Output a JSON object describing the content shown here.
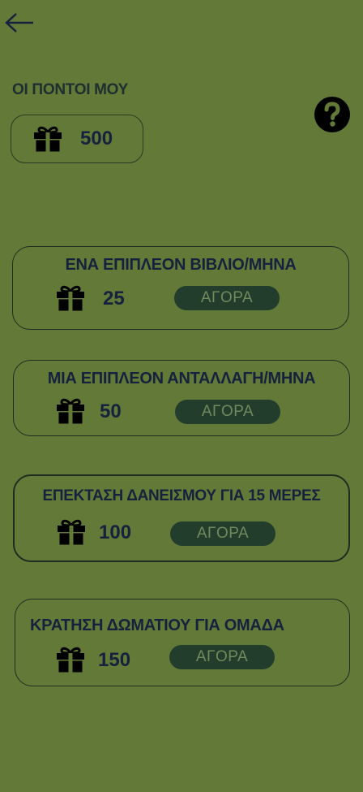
{
  "header": {
    "back_icon": "arrow-left-icon"
  },
  "points": {
    "title": "ΟΙ ΠΟΝΤΟΙ ΜΟΥ",
    "value": "500",
    "icon": "gift-icon",
    "help_icon": "question-circle-icon"
  },
  "rewards": [
    {
      "title": "ΕΝΑ ΕΠΙΠΛΕΟΝ ΒΙΒΛΙΟ/ΜΗΝΑ",
      "cost": "25",
      "button": "ΑΓΟΡΑ"
    },
    {
      "title": "ΜΙΑ ΕΠΙΠΛΕΟΝ ΑΝΤΑΛΛΑΓΗ/ΜΗΝΑ",
      "cost": "50",
      "button": "ΑΓΟΡΑ"
    },
    {
      "title": "ΕΠΕΚΤΑΣΗ ΔΑΝΕΙΣΜΟΥ ΓΙΑ 15 ΜΕΡΕΣ",
      "cost": "100",
      "button": "ΑΓΟΡΑ"
    },
    {
      "title": "ΚΡΑΤΗΣΗ ΔΩΜΑΤΙΟΥ ΓΙΑ ΟΜΑΔΑ",
      "cost": "150",
      "button": "ΑΓΟΡΑ"
    }
  ],
  "colors": {
    "background": "#627938",
    "text": "#16223d",
    "button": "#233d2c",
    "button_text": "#6f8a5c"
  }
}
